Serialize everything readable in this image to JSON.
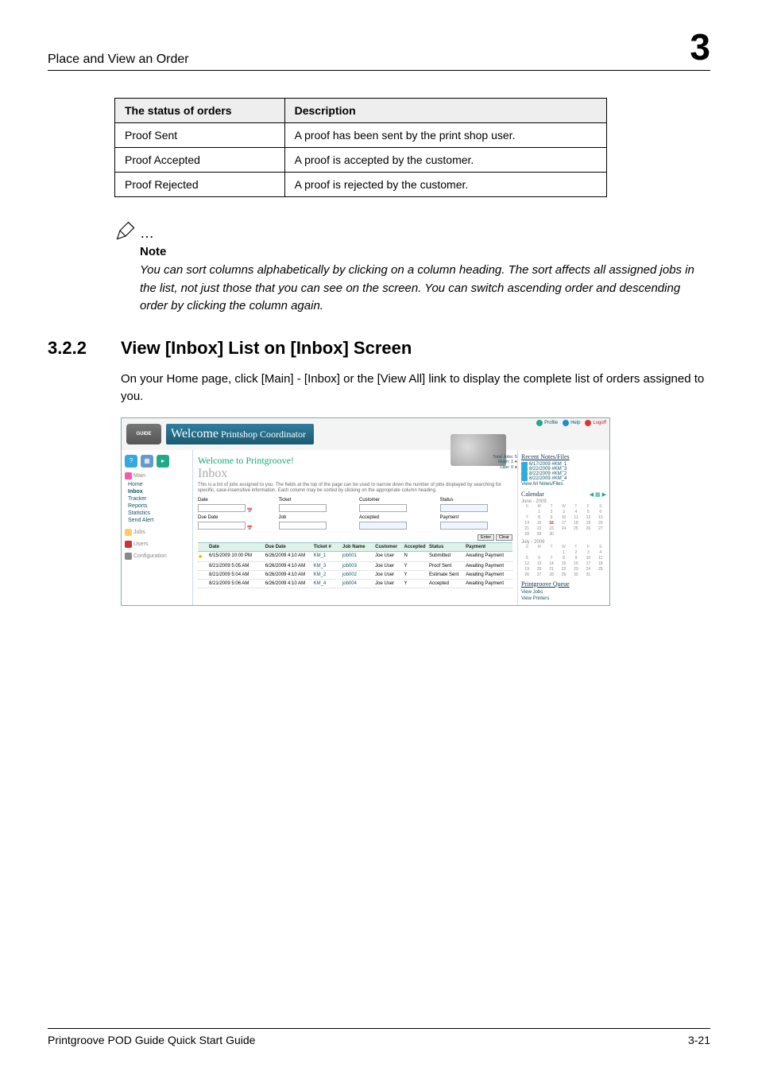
{
  "header": {
    "title": "Place and View an Order",
    "chapter": "3"
  },
  "status_table": {
    "col1": "The status of orders",
    "col2": "Description",
    "rows": [
      {
        "status": "Proof Sent",
        "desc": "A proof has been sent by the print shop user."
      },
      {
        "status": "Proof Accepted",
        "desc": "A proof is accepted by the customer."
      },
      {
        "status": "Proof Rejected",
        "desc": "A proof is rejected by the customer."
      }
    ]
  },
  "note": {
    "dots": "…",
    "heading": "Note",
    "body": "You can sort columns alphabetically by clicking on a column heading. The sort affects all assigned jobs in the list, not just those that you can see on the screen. You can switch ascending order and descending order by clicking the column again."
  },
  "section": {
    "number": "3.2.2",
    "title": "View [Inbox] List on [Inbox] Screen",
    "body": "On your Home page, click [Main] - [Inbox] or the [View All] link to display the complete list of orders assigned to you."
  },
  "screenshot": {
    "logo": "GUIDE",
    "welcome": {
      "big": "Welcome",
      "small": " Printshop Coordinator"
    },
    "toplinks": {
      "profile": "Profile",
      "help": "Help",
      "logoff": "Logoff"
    },
    "sidebar": {
      "main": "Main",
      "links_main": [
        "Home",
        "Inbox",
        "Tracker",
        "Reports",
        "Statistics",
        "Send Alert"
      ],
      "jobs": "Jobs",
      "users": "Users",
      "config": "Configuration"
    },
    "main": {
      "hello": "Welcome to Printgroove!",
      "inbox": "Inbox",
      "summary": {
        "total": "Total Jobs: 5",
        "rush": "Rush: 1",
        "late": "Late: 0"
      },
      "desc": "This is a list of jobs assigned to you. The fields at the top of the page can be used to narrow down the number of jobs displayed by searching for specific, case-insensitive information. Each column may be sorted by clicking on the appropriate column heading.",
      "filters": {
        "date": "Date",
        "duedate": "Due Date",
        "ticket": "Ticket",
        "job": "Job",
        "customer": "Customer",
        "accepted": "Accepted",
        "status": "Status",
        "payment": "Payment",
        "enter": "Enter",
        "clear": "Clear"
      },
      "headers": [
        "",
        "Date",
        "Due Date",
        "Ticket #",
        "Job Name",
        "Customer",
        "Accepted",
        "Status",
        "Payment"
      ],
      "rows": [
        {
          "star": true,
          "date": "6/15/2009 10:00 PM",
          "due": "6/26/2009 4:10 AM",
          "ticket": "KM_1",
          "job": "job001",
          "customer": "Joe User",
          "accepted": "N",
          "status": "Submitted",
          "payment": "Awaiting Payment"
        },
        {
          "star": false,
          "date": "8/21/2009 5:05 AM",
          "due": "6/26/2009 4:10 AM",
          "ticket": "KM_3",
          "job": "job003",
          "customer": "Joe User",
          "accepted": "Y",
          "status": "Proof Sent",
          "payment": "Awaiting Payment"
        },
        {
          "star": false,
          "date": "8/21/2009 5:04 AM",
          "due": "6/26/2009 4:10 AM",
          "ticket": "KM_2",
          "job": "job002",
          "customer": "Joe User",
          "accepted": "Y",
          "status": "Estimate Sent",
          "payment": "Awaiting Payment"
        },
        {
          "star": false,
          "date": "8/21/2009 5:06 AM",
          "due": "6/26/2009 4:10 AM",
          "ticket": "KM_4",
          "job": "job004",
          "customer": "Joe User",
          "accepted": "Y",
          "status": "Accepted",
          "payment": "Awaiting Payment"
        }
      ]
    },
    "right": {
      "recent_heading": "Recent Notes/Files",
      "notes": [
        "6/17/2009 #KM_1",
        "8/22/2009 #KM_3",
        "8/22/2009 #KM_2",
        "8/22/2009 #KM_4"
      ],
      "viewall": "View All Notes/Files",
      "calendar": "Calendar",
      "june": "June - 2009",
      "july": "July - 2009",
      "queue": "Printgroove Queue",
      "qlinks": [
        "View Jobs",
        "View Printers"
      ]
    }
  },
  "footer": {
    "left": "Printgroove POD Guide Quick Start Guide",
    "right": "3-21"
  }
}
